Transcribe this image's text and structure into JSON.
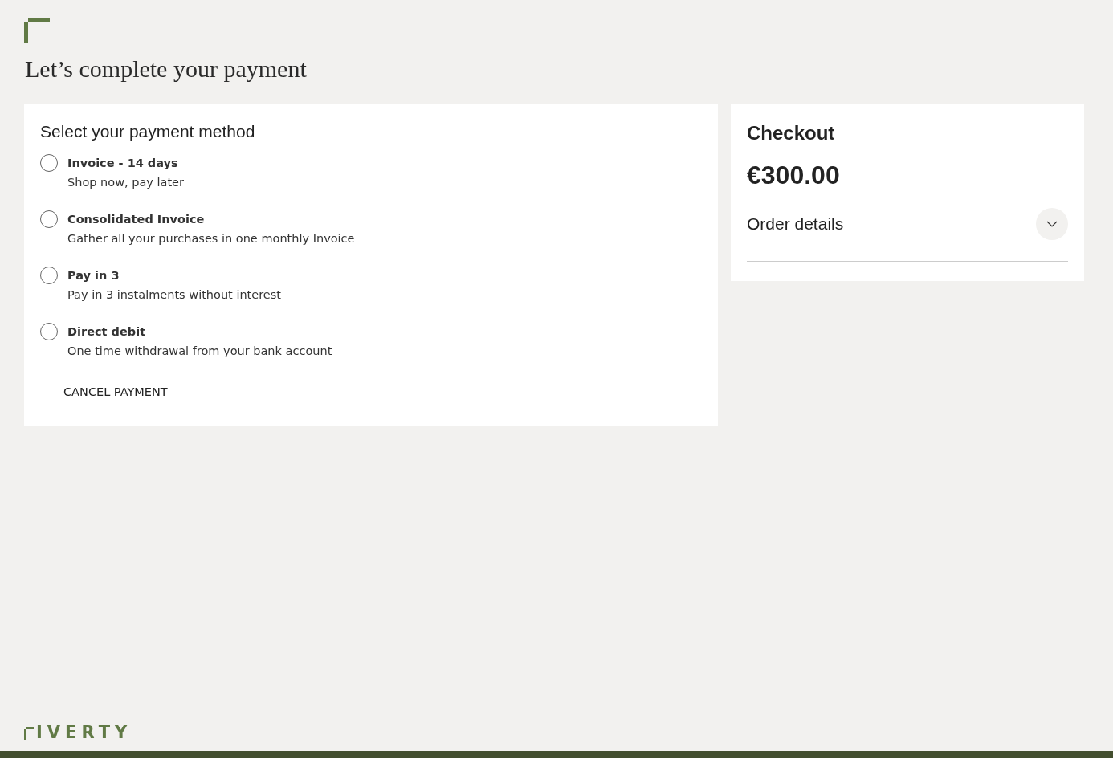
{
  "heading": "Let’s complete your payment",
  "payment": {
    "title": "Select your payment method",
    "options": [
      {
        "label": "Invoice - 14 days",
        "description": "Shop now, pay later",
        "selected": false
      },
      {
        "label": "Consolidated Invoice",
        "description": "Gather all your purchases in one monthly Invoice",
        "selected": false
      },
      {
        "label": "Pay in 3",
        "description": "Pay in 3 instalments without interest",
        "selected": false
      },
      {
        "label": "Direct debit",
        "description": "One time withdrawal from your bank account",
        "selected": false
      }
    ],
    "cancel": "CANCEL PAYMENT"
  },
  "checkout": {
    "title": "Checkout",
    "amount": "€300.00",
    "order_details": {
      "label": "Order details",
      "expanded": false
    }
  },
  "footer": {
    "brand": "IVERTY"
  }
}
